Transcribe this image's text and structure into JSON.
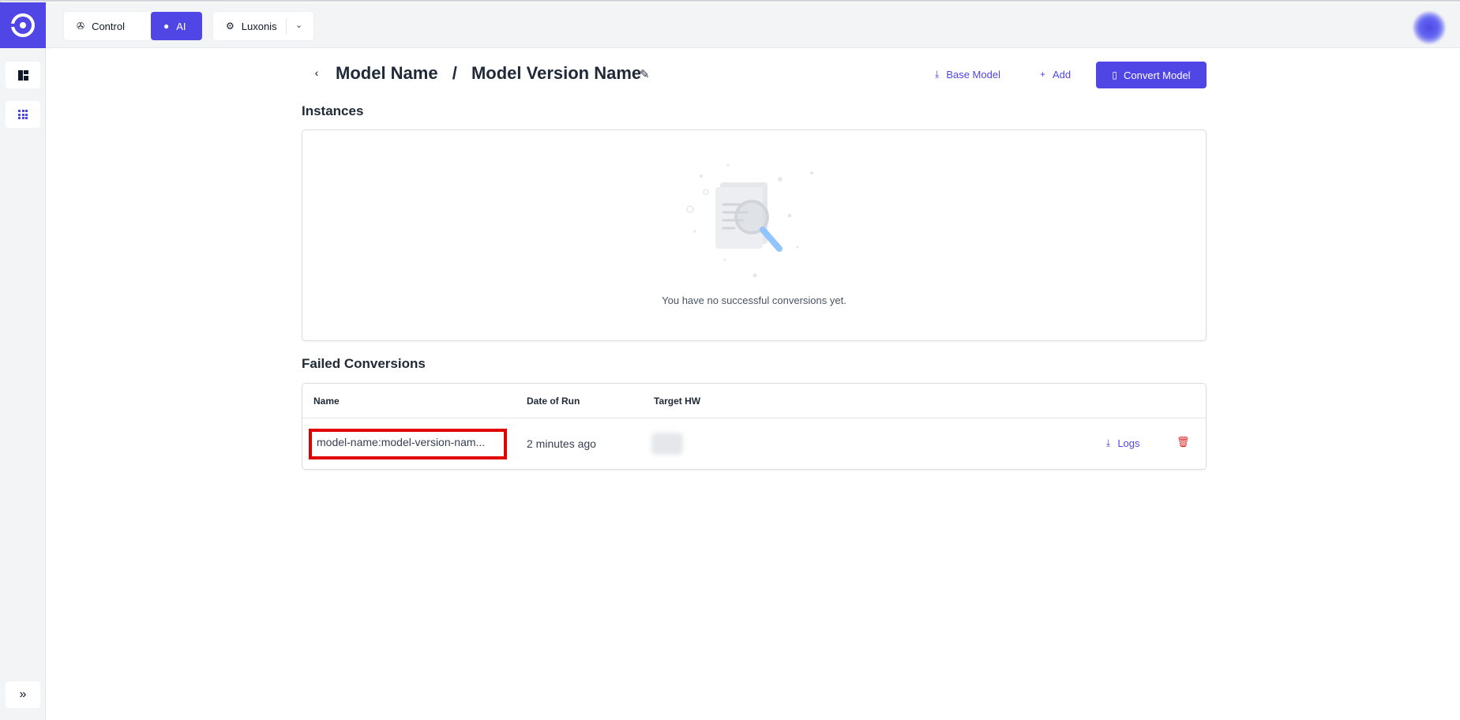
{
  "header": {
    "nav": [
      {
        "label": "Control",
        "icon": "aperture-icon",
        "active": false
      },
      {
        "label": "AI",
        "icon": "lightbulb-icon",
        "active": true
      },
      {
        "label": "Luxonis",
        "icon": "gear-icon",
        "active": false
      }
    ],
    "org_dropdown_icon": "chevron-down-icon",
    "colors": {
      "accent": "#4f46e5",
      "danger": "#dc2626",
      "bg": "#f3f4f6"
    }
  },
  "sidebar": {
    "items": [
      {
        "icon": "dashboard-icon"
      },
      {
        "icon": "apps-grid-icon"
      }
    ],
    "expand_icon": "double-chevron-right-icon"
  },
  "page": {
    "breadcrumb": {
      "model_name": "Model Name",
      "separator": "/",
      "version_name": "Model Version Name"
    },
    "actions": {
      "base_model_label": "Base Model",
      "add_label": "Add",
      "convert_label": "Convert Model"
    },
    "instances": {
      "heading": "Instances",
      "empty_text": "You have no successful conversions yet."
    },
    "failed": {
      "heading": "Failed Conversions",
      "columns": {
        "name": "Name",
        "date": "Date of Run",
        "target": "Target HW"
      },
      "rows": [
        {
          "name": "model-name:model-version-nam...",
          "date": "2 minutes ago",
          "logs_label": "Logs"
        }
      ]
    }
  }
}
